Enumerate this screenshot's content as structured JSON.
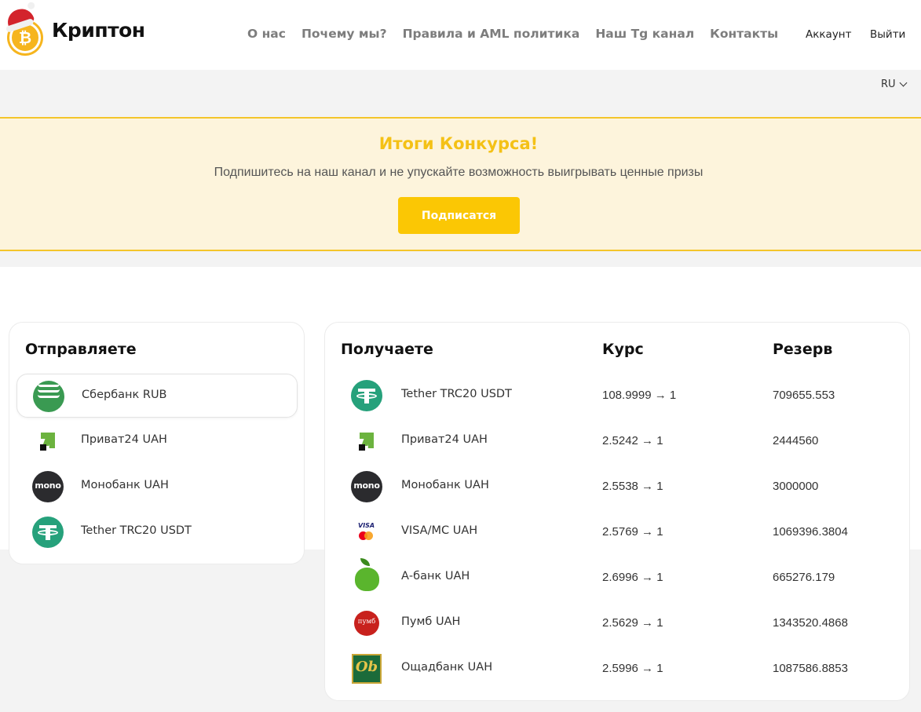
{
  "header": {
    "logo_text": "Криптон",
    "nav": [
      "О нас",
      "Почему мы?",
      "Правила и AML политика",
      "Наш Tg канал",
      "Контакты"
    ],
    "account": "Аккаунт",
    "logout": "Выйти",
    "language": "RU"
  },
  "banner": {
    "title": "Итоги Конкурса!",
    "text": "Подпишитесь на наш канал и не упускайте возможность выигрывать ценные призы",
    "button": "Подписатся"
  },
  "send": {
    "title": "Отправляете",
    "items": [
      {
        "label": "Сбербанк RUB",
        "icon": "sberbank-icon",
        "selected": true
      },
      {
        "label": "Приват24 UAH",
        "icon": "privat24-icon",
        "selected": false
      },
      {
        "label": "Монобанк UAH",
        "icon": "monobank-icon",
        "selected": false
      },
      {
        "label": "Tether TRC20 USDT",
        "icon": "tether-icon",
        "selected": false
      }
    ]
  },
  "receive": {
    "title": "Получаете",
    "rate_header": "Курс",
    "reserve_header": "Резерв",
    "icon_texts": {
      "mono": "mono",
      "visa": "VISA",
      "pumb": "пумб",
      "oshad": "Ob"
    },
    "items": [
      {
        "label": "Tether TRC20 USDT",
        "rate": "108.9999 → 1",
        "reserve": "709655.553",
        "icon": "tether-icon"
      },
      {
        "label": "Приват24 UAH",
        "rate": "2.5242 → 1",
        "reserve": "2444560",
        "icon": "privat24-icon"
      },
      {
        "label": "Монобанк UAH",
        "rate": "2.5538 → 1",
        "reserve": "3000000",
        "icon": "monobank-icon"
      },
      {
        "label": "VISA/MC UAH",
        "rate": "2.5769 → 1",
        "reserve": "1069396.3804",
        "icon": "visa-mastercard-icon"
      },
      {
        "label": "А-банк UAH",
        "rate": "2.6996 → 1",
        "reserve": "665276.179",
        "icon": "abank-apple-icon"
      },
      {
        "label": "Пумб UAH",
        "rate": "2.5629 → 1",
        "reserve": "1343520.4868",
        "icon": "pumb-icon"
      },
      {
        "label": "Ощадбанк UAH",
        "rate": "2.5996 → 1",
        "reserve": "1087586.8853",
        "icon": "oschadbank-icon"
      }
    ]
  }
}
